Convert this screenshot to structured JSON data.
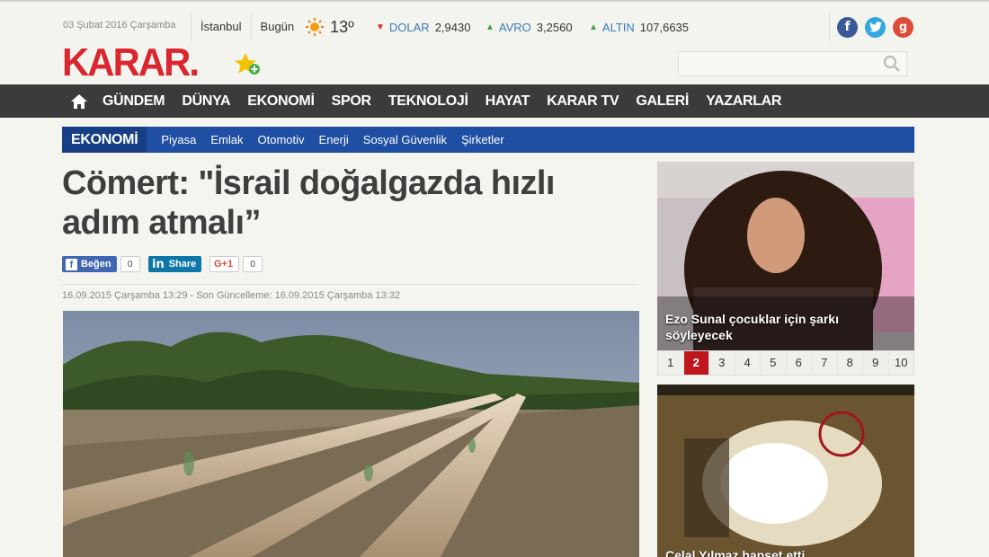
{
  "header": {
    "date": "03 Şubat 2016 Çarşamba",
    "weather": {
      "city": "İstanbul",
      "day": "Bugün",
      "temp": "13º",
      "icon": "sun-icon"
    },
    "markets": [
      {
        "name": "DOLAR",
        "value": "2,9430",
        "trend": "down",
        "color": "#d9262f"
      },
      {
        "name": "AVRO",
        "value": "3,2560",
        "trend": "up",
        "color": "#3fa34d"
      },
      {
        "name": "ALTIN",
        "value": "107,6635",
        "trend": "up",
        "color": "#3fa34d"
      }
    ],
    "social": {
      "facebook": "f",
      "twitter": "t",
      "google": "g"
    },
    "logo": "KARAR.",
    "search_placeholder": ""
  },
  "nav": {
    "items": [
      "GÜNDEM",
      "DÜNYA",
      "EKONOMİ",
      "SPOR",
      "TEKNOLOJİ",
      "HAYAT",
      "KARAR TV",
      "GALERİ",
      "YAZARLAR"
    ]
  },
  "subnav": {
    "section": "EKONOMİ",
    "items": [
      "Piyasa",
      "Emlak",
      "Otomotiv",
      "Enerji",
      "Sosyal Güvenlik",
      "Şirketler"
    ]
  },
  "article": {
    "title": "Cömert: \"İsrail doğalgazda hızlı adım atmalı”",
    "share": {
      "facebook_label": "Beğen",
      "facebook_count": "0",
      "linkedin_label": "Share",
      "google_label": "G+1",
      "google_count": "0"
    },
    "meta": "16.09.2015 Çarşamba 13:29 - Son Güncelleme: 16.09.2015 Çarşamba 13:32"
  },
  "sidebar": {
    "headline1": "Ezo Sunal çocuklar için şarkı söyleyecek",
    "pages": [
      "1",
      "2",
      "3",
      "4",
      "5",
      "6",
      "7",
      "8",
      "9",
      "10"
    ],
    "active_page": "2",
    "headline2": "Celal Yılmaz hapset etti"
  },
  "colors": {
    "brand": "#d9262f",
    "nav": "#3b3b3b",
    "subnav": "#1e4fa3",
    "accent": "#c0171e"
  }
}
